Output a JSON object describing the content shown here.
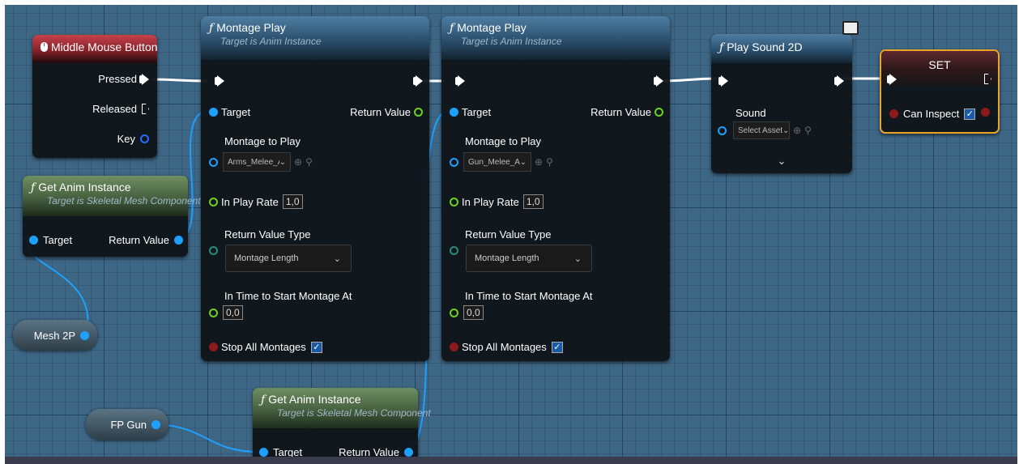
{
  "nodes": {
    "mmb": {
      "title": "Middle Mouse Button",
      "pressed": "Pressed",
      "released": "Released",
      "key": "Key"
    },
    "get_anim_1": {
      "title": "Get Anim Instance",
      "subtitle": "Target is Skeletal Mesh Component",
      "target": "Target",
      "return_value": "Return Value"
    },
    "mesh2p": {
      "label": "Mesh 2P"
    },
    "fpgun": {
      "label": "FP Gun"
    },
    "montage_1": {
      "title": "Montage Play",
      "subtitle": "Target is Anim Instance",
      "target": "Target",
      "return_value": "Return Value",
      "montage_to_play": "Montage to Play",
      "montage_asset": "Arms_Melee_At",
      "in_play_rate": "In Play Rate",
      "play_rate_value": "1,0",
      "return_value_type": "Return Value Type",
      "return_type_value": "Montage Length",
      "in_time": "In Time to Start Montage At",
      "in_time_value": "0,0",
      "stop_all": "Stop All Montages"
    },
    "montage_2": {
      "title": "Montage Play",
      "subtitle": "Target is Anim Instance",
      "target": "Target",
      "return_value": "Return Value",
      "montage_to_play": "Montage to Play",
      "montage_asset": "Gun_Melee_Att",
      "in_play_rate": "In Play Rate",
      "play_rate_value": "1,0",
      "return_value_type": "Return Value Type",
      "return_type_value": "Montage Length",
      "in_time": "In Time to Start Montage At",
      "in_time_value": "0,0",
      "stop_all": "Stop All Montages"
    },
    "get_anim_2": {
      "title": "Get Anim Instance",
      "subtitle": "Target is Skeletal Mesh Component",
      "target": "Target",
      "return_value": "Return Value"
    },
    "play_sound": {
      "title": "Play Sound 2D",
      "sound": "Sound",
      "sound_asset": "Select Asset"
    },
    "set": {
      "title": "SET",
      "var": "Can Inspect"
    }
  },
  "colors": {
    "exec_wire": "#ffffff",
    "object_wire": "#1ea0ff",
    "set_border": "#e8a32a"
  },
  "icons": {
    "function": "function-icon",
    "monitor": "monitor-icon",
    "mouse": "mouse-icon"
  }
}
